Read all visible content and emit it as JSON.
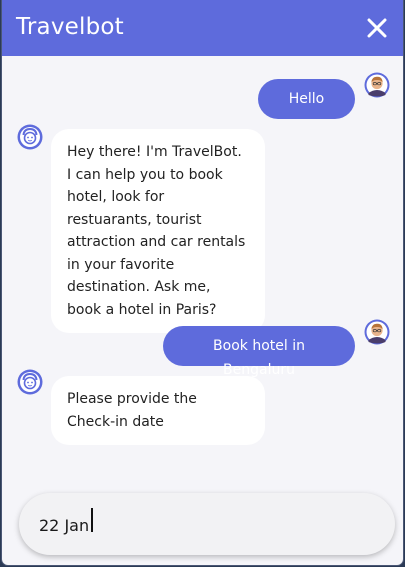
{
  "header": {
    "title": "Travelbot",
    "close_icon": "close-icon"
  },
  "messages": [
    {
      "from": "user",
      "text": "Hello"
    },
    {
      "from": "bot",
      "text": "Hey there! I'm TravelBot. I can help you to book hotel, look for restuarants, tourist attraction and car rentals in your favorite destination. Ask me, book a hotel in Paris?"
    },
    {
      "from": "user",
      "text": "Book hotel in Bengaluru"
    },
    {
      "from": "bot",
      "text": "Please provide the Check-in date"
    }
  ],
  "composer": {
    "value": "22 Jan"
  },
  "colors": {
    "accent": "#5e6bdc",
    "background": "#f5f5f9",
    "bot_bubble": "#ffffff"
  },
  "icons": {
    "user_avatar": "user-avatar-icon",
    "bot_avatar": "bot-avatar-icon"
  }
}
